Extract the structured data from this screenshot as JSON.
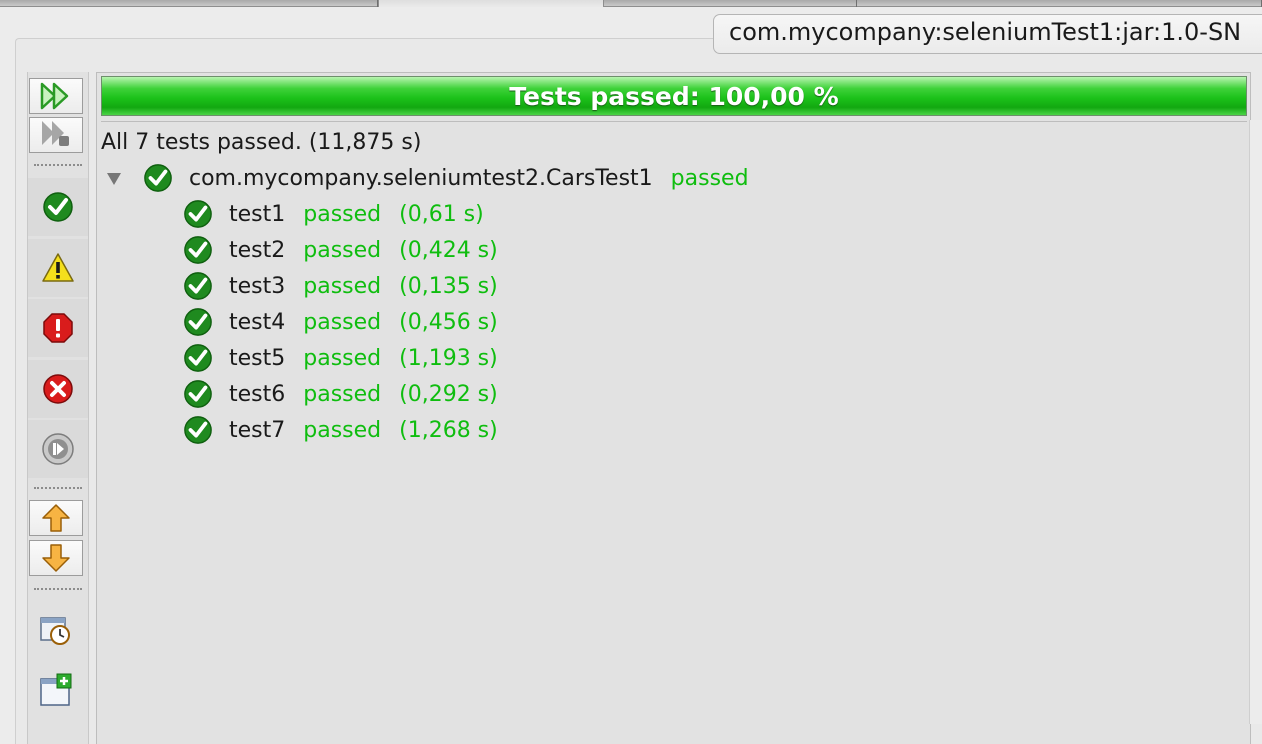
{
  "window": {
    "title_tab": "com.mycompany:seleniumTest1:jar:1.0-SN"
  },
  "toolbar": {
    "buttons": [
      {
        "name": "rerun-all",
        "icon": "double-play-icon"
      },
      {
        "name": "rerun-failed",
        "icon": "play-stop-icon"
      },
      {
        "name": "show-passed",
        "icon": "check-circle-icon"
      },
      {
        "name": "show-warnings",
        "icon": "warning-triangle-icon"
      },
      {
        "name": "show-errors",
        "icon": "error-octagon-icon"
      },
      {
        "name": "show-failures",
        "icon": "x-circle-icon"
      },
      {
        "name": "show-skipped",
        "icon": "skip-circle-icon"
      },
      {
        "name": "previous-failure",
        "icon": "arrow-up-icon"
      },
      {
        "name": "next-failure",
        "icon": "arrow-down-icon"
      },
      {
        "name": "history",
        "icon": "clock-window-icon"
      },
      {
        "name": "new-window",
        "icon": "window-plus-icon"
      }
    ]
  },
  "progress": {
    "label": "Tests passed: 100,00 %",
    "percent": 100,
    "color": "#1cc21a"
  },
  "results": {
    "summary": "All 7 tests passed. (11,875 s)",
    "suite": {
      "name": "com.mycompany.seleniumtest2.CarsTest1",
      "status": "passed",
      "tests": [
        {
          "name": "test1",
          "status": "passed",
          "time": "(0,61 s)"
        },
        {
          "name": "test2",
          "status": "passed",
          "time": "(0,424 s)"
        },
        {
          "name": "test3",
          "status": "passed",
          "time": "(0,135 s)"
        },
        {
          "name": "test4",
          "status": "passed",
          "time": "(0,456 s)"
        },
        {
          "name": "test5",
          "status": "passed",
          "time": "(1,193 s)"
        },
        {
          "name": "test6",
          "status": "passed",
          "time": "(0,292 s)"
        },
        {
          "name": "test7",
          "status": "passed",
          "time": "(1,268 s)"
        }
      ]
    }
  },
  "colors": {
    "passed": "#0fbd0f",
    "check_fill": "#1f8a1f"
  }
}
